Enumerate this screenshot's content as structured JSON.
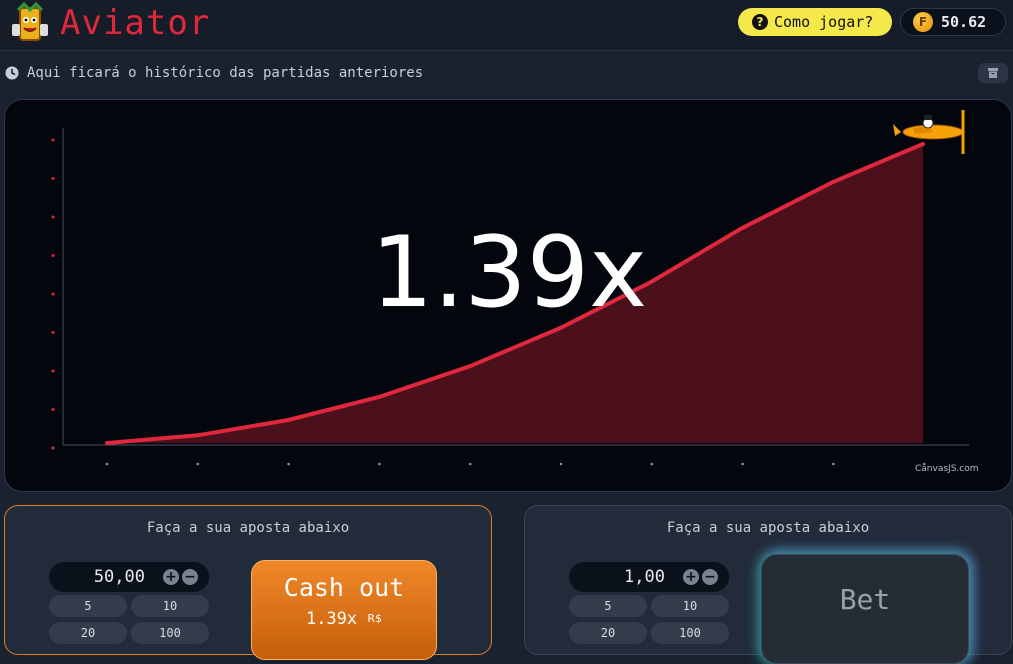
{
  "header": {
    "logo_text": "Aviator",
    "help_label": "Como jogar?",
    "help_icon": "question-circle-icon",
    "balance": "50.62",
    "coin_symbol": "F",
    "colors": {
      "brand": "#e0283c",
      "help_bg": "#f4e84a",
      "coin": "#f2a500"
    }
  },
  "history": {
    "icon": "clock-icon",
    "text": "Aqui ficará o histórico das partidas anteriores",
    "archive_icon": "archive-icon"
  },
  "game": {
    "multiplier": "1.39x",
    "credit": "CanvasJS.com",
    "plane_icon": "airplane-icon",
    "colors": {
      "curve": "#e0283c",
      "fill": "#4c0f1c",
      "background": "#04060e"
    }
  },
  "chart_data": {
    "type": "area",
    "x": [
      0,
      1,
      2,
      3,
      4,
      5,
      6,
      7,
      8,
      9
    ],
    "values": [
      1.0,
      1.01,
      1.03,
      1.06,
      1.1,
      1.15,
      1.21,
      1.28,
      1.34,
      1.39
    ],
    "grid": false
  },
  "bets": [
    {
      "title": "Faça a sua aposta abaixo",
      "amount": "50,00",
      "chips": [
        "5",
        "10",
        "20",
        "100"
      ],
      "button_label": "Cash out",
      "button_value": "1.39x",
      "button_currency": "R$",
      "accent": "#e07c1a"
    },
    {
      "title": "Faça a sua aposta abaixo",
      "amount": "1,00",
      "chips": [
        "5",
        "10",
        "20",
        "100"
      ],
      "button_label": "Bet"
    }
  ]
}
